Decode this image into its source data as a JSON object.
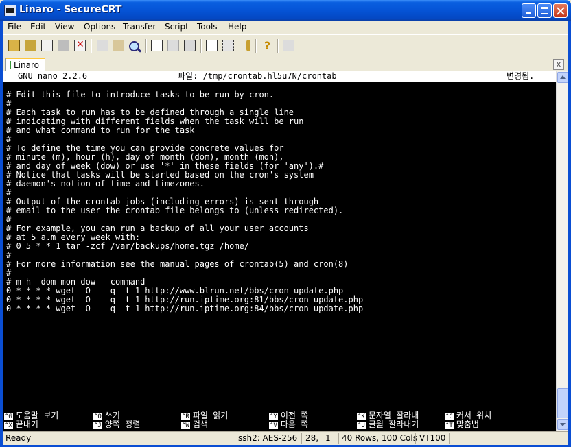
{
  "window": {
    "title": "Linaro - SecureCRT"
  },
  "menu": [
    "File",
    "Edit",
    "View",
    "Options",
    "Transfer",
    "Script",
    "Tools",
    "Help"
  ],
  "tab": {
    "label": "Linaro",
    "close": "x"
  },
  "nano_header": {
    "left": "GNU nano 2.2.6",
    "center": "파일: /tmp/crontab.hl5u7N/crontab",
    "right": "변경됨."
  },
  "crontab_lines": [
    "# Edit this file to introduce tasks to be run by cron.",
    "#",
    "# Each task to run has to be defined through a single line",
    "# indicating with different fields when the task will be run",
    "# and what command to run for the task",
    "#",
    "# To define the time you can provide concrete values for",
    "# minute (m), hour (h), day of month (dom), month (mon),",
    "# and day of week (dow) or use '*' in these fields (for 'any').#",
    "# Notice that tasks will be started based on the cron's system",
    "# daemon's notion of time and timezones.",
    "#",
    "# Output of the crontab jobs (including errors) is sent through",
    "# email to the user the crontab file belongs to (unless redirected).",
    "#",
    "# For example, you can run a backup of all your user accounts",
    "# at 5 a.m every week with:",
    "# 0 5 * * 1 tar -zcf /var/backups/home.tgz /home/",
    "#",
    "# For more information see the manual pages of crontab(5) and cron(8)",
    "#",
    "# m h  dom mon dow   command",
    "0 * * * * wget -O - -q -t 1 http://www.blrun.net/bbs/cron_update.php",
    "0 * * * * wget -O - -q -t 1 http://run.iptime.org:81/bbs/cron_update.php",
    "0 * * * * wget -O - -q -t 1 http://run.iptime.org:84/bbs/cron_update.php"
  ],
  "shortcuts_row1": [
    {
      "key": "^G",
      "label": "도움말 보기"
    },
    {
      "key": "^O",
      "label": "쓰기"
    },
    {
      "key": "^R",
      "label": "파일 읽기"
    },
    {
      "key": "^Y",
      "label": "이전 쪽"
    },
    {
      "key": "^K",
      "label": "문자열 잘라내"
    },
    {
      "key": "^C",
      "label": "커서 위치"
    }
  ],
  "shortcuts_row2": [
    {
      "key": "^X",
      "label": "끝내기"
    },
    {
      "key": "^J",
      "label": "양쪽 정렬"
    },
    {
      "key": "^W",
      "label": "검색"
    },
    {
      "key": "^V",
      "label": "다음 쪽"
    },
    {
      "key": "^U",
      "label": "글월 잘라내기"
    },
    {
      "key": "^T",
      "label": "맞춤법"
    }
  ],
  "status": {
    "ready": "Ready",
    "protocol": "ssh2: AES-256",
    "row": "28,",
    "col": "1",
    "size": "40 Rows, 100 Cols",
    "emulation": "VT100"
  },
  "toolbar_icons": [
    "connect-icon",
    "quick-connect-icon",
    "connect-in-tab-icon",
    "reconnect-icon",
    "disconnect-icon",
    "copy-icon",
    "paste-icon",
    "find-icon",
    "print-setup-icon",
    "print-selection-icon",
    "print-icon",
    "session-options-icon",
    "global-options-icon",
    "keymap-icon",
    "help-icon",
    "sftp-icon"
  ]
}
